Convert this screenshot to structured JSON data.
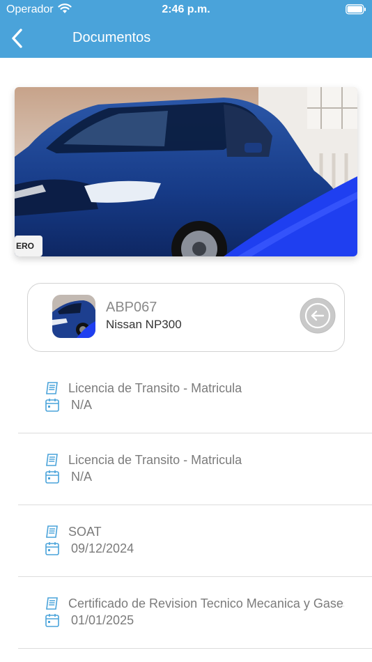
{
  "status_bar": {
    "carrier": "Operador",
    "time": "2:46 p.m."
  },
  "navbar": {
    "title": "Documentos",
    "back_icon": "chevron-left-icon"
  },
  "vehicle": {
    "plate": "ABP067",
    "model": "Nissan NP300",
    "action_icon": "arrow-left-circle-icon"
  },
  "documents": [
    {
      "name": "Licencia de Transito - Matricula",
      "date": "N/A"
    },
    {
      "name": "Licencia de Transito - Matricula",
      "date": "N/A"
    },
    {
      "name": "SOAT",
      "date": "09/12/2024"
    },
    {
      "name": "Certificado de Revision Tecnico Mecanica y Gases",
      "date": "01/01/2025"
    }
  ],
  "colors": {
    "header": "#4aa3da",
    "icon": "#4aa3da"
  }
}
